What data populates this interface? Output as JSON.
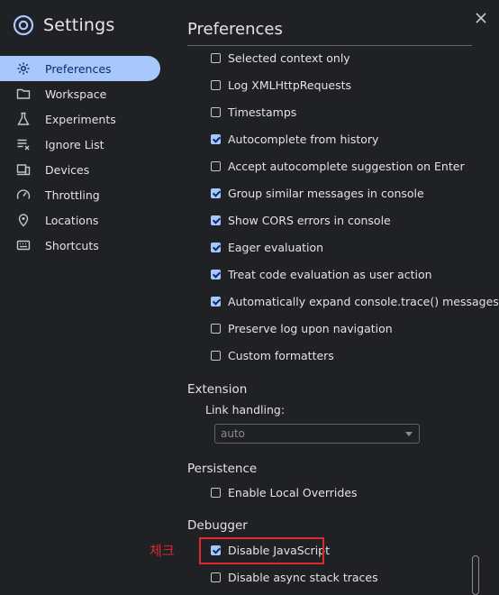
{
  "sidebar": {
    "title": "Settings",
    "items": [
      {
        "label": "Preferences",
        "icon": "gear-icon",
        "active": true
      },
      {
        "label": "Workspace",
        "icon": "folder-icon",
        "active": false
      },
      {
        "label": "Experiments",
        "icon": "flask-icon",
        "active": false
      },
      {
        "label": "Ignore List",
        "icon": "ignore-list-icon",
        "active": false
      },
      {
        "label": "Devices",
        "icon": "devices-icon",
        "active": false
      },
      {
        "label": "Throttling",
        "icon": "speedometer-icon",
        "active": false
      },
      {
        "label": "Locations",
        "icon": "location-pin-icon",
        "active": false
      },
      {
        "label": "Shortcuts",
        "icon": "keyboard-icon",
        "active": false
      }
    ]
  },
  "main": {
    "title": "Preferences",
    "console_options": [
      {
        "label": "Selected context only",
        "checked": false
      },
      {
        "label": "Log XMLHttpRequests",
        "checked": false
      },
      {
        "label": "Timestamps",
        "checked": false
      },
      {
        "label": "Autocomplete from history",
        "checked": true
      },
      {
        "label": "Accept autocomplete suggestion on Enter",
        "checked": false
      },
      {
        "label": "Group similar messages in console",
        "checked": true
      },
      {
        "label": "Show CORS errors in console",
        "checked": true
      },
      {
        "label": "Eager evaluation",
        "checked": true
      },
      {
        "label": "Treat code evaluation as user action",
        "checked": true
      },
      {
        "label": "Automatically expand console.trace() messages",
        "checked": true
      },
      {
        "label": "Preserve log upon navigation",
        "checked": false
      },
      {
        "label": "Custom formatters",
        "checked": false
      }
    ],
    "extension": {
      "heading": "Extension",
      "link_handling_label": "Link handling:",
      "link_handling_value": "auto"
    },
    "persistence": {
      "heading": "Persistence",
      "options": [
        {
          "label": "Enable Local Overrides",
          "checked": false
        }
      ]
    },
    "debugger": {
      "heading": "Debugger",
      "options": [
        {
          "label": "Disable JavaScript",
          "checked": true
        },
        {
          "label": "Disable async stack traces",
          "checked": false
        }
      ]
    }
  },
  "annotation": {
    "text": "체크",
    "color": "#e0282f"
  },
  "colors": {
    "background": "#202124",
    "accent": "#a8c7fa",
    "highlight": "#e0282f"
  }
}
